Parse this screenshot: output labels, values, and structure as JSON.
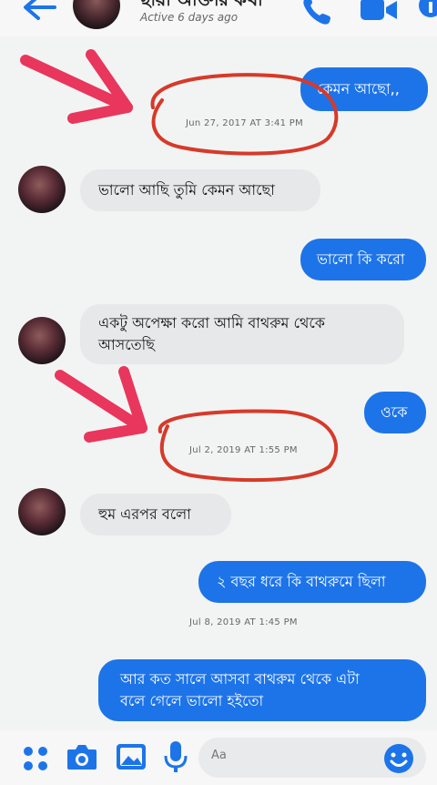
{
  "header": {
    "contact_name": "ছায়া আক্তার কথা",
    "status": "Active 6 days ago"
  },
  "messages": [
    {
      "text": "কেমন আছো,,"
    },
    {
      "text": "ভালো আছি তুমি কেমন আছো"
    },
    {
      "text": "ভালো কি করো"
    },
    {
      "text_line1": "একটু অপেক্ষা করো আমি বাথরুম থেকে",
      "text_line2": "আসতেছি"
    },
    {
      "text": "ওকে"
    },
    {
      "text": "হুম এরপর বলো"
    },
    {
      "text": "২ বছর ধরে কি বাথরুমে ছিলা"
    },
    {
      "text_line1": "আর কত সালে আসবা বাথরুম থেকে এটা",
      "text_line2": "বলে গেলে ভালো হইতো"
    }
  ],
  "timestamps": {
    "t1": "Jun 27, 2017 AT 3:41 PM",
    "t2": "Jul 2, 2019 AT 1:55 PM",
    "t3": "Jul 8, 2019 AT 1:45 PM"
  },
  "composer": {
    "placeholder": "Aa"
  },
  "colors": {
    "accent": "#1d74e9",
    "annotation_circle": "#d63a2a",
    "annotation_arrow": "#e8365d"
  },
  "icons": [
    "back-arrow-icon",
    "phone-icon",
    "video-camera-icon",
    "info-icon",
    "menu-dots-icon",
    "camera-icon",
    "image-icon",
    "microphone-icon",
    "emoji-icon"
  ]
}
